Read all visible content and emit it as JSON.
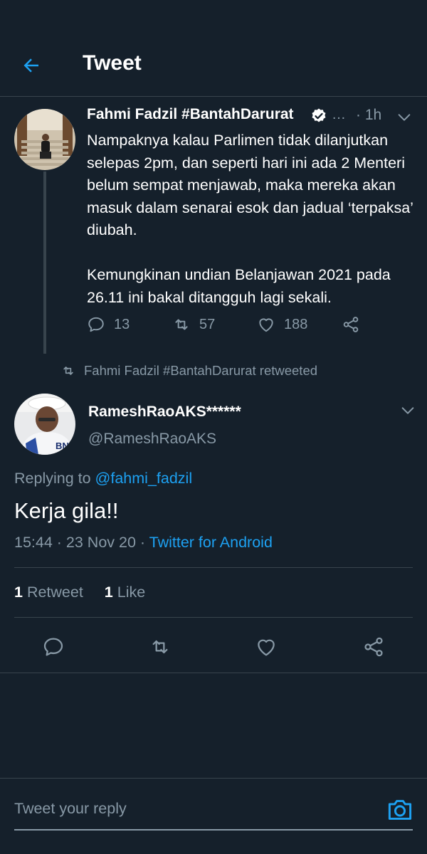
{
  "header": {
    "title": "Tweet"
  },
  "parent_tweet": {
    "author_name": "Fahmi Fadzil #BantahDarurat",
    "time": "· 1h",
    "ellipsis": "…",
    "text_p1": "Nampaknya kalau Parlimen tidak dilanjutkan selepas 2pm, dan seperti hari ini ada 2 Menteri belum sempat menjawab, maka mereka akan masuk dalam senarai esok dan jadual ‘terpaksa’ diubah.",
    "text_p2": "Kemungkinan undian Belanjawan 2021 pada 26.11 ini bakal ditangguh lagi sekali.",
    "replies": "13",
    "retweets": "57",
    "likes": "188"
  },
  "retweet_context": "Fahmi Fadzil #BantahDarurat retweeted",
  "main_tweet": {
    "author_name": "RameshRaoAKS******",
    "handle": "@RameshRaoAKS",
    "replying_prefix": "Replying to ",
    "replying_to": "@fahmi_fadzil",
    "text": "Kerja gila!!",
    "timestamp": "15:44 · 23 Nov 20 · ",
    "source": "Twitter for Android",
    "retweet_count": "1",
    "retweet_label": " Retweet",
    "like_count": "1",
    "like_label": " Like"
  },
  "reply_bar": {
    "placeholder": "Tweet your reply"
  },
  "icons": {
    "back": "arrow-left-icon",
    "verified": "verified-badge-icon",
    "caret": "chevron-down-icon",
    "reply": "reply-icon",
    "retweet": "retweet-icon",
    "like": "heart-icon",
    "share": "share-icon",
    "camera": "camera-icon"
  },
  "colors": {
    "background": "#15202b",
    "accent": "#1da1f2",
    "secondary_text": "#8899a6",
    "divider": "#38444d"
  }
}
